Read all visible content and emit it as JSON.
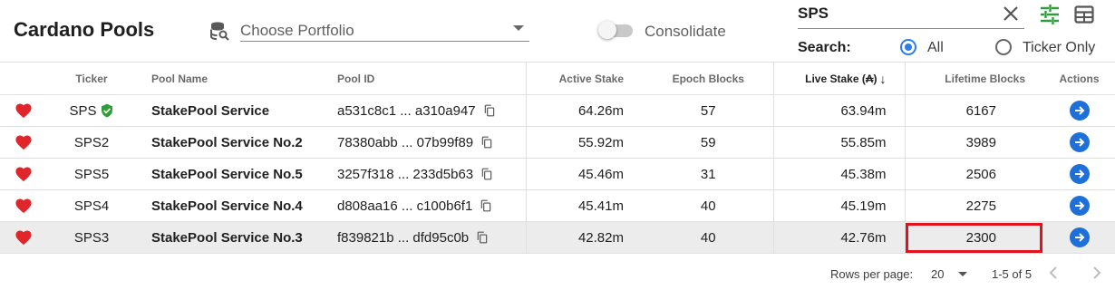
{
  "app": {
    "title": "Cardano Pools"
  },
  "portfolio": {
    "placeholder": "Choose Portfolio",
    "icon": "database-search-icon"
  },
  "consolidate": {
    "label": "Consolidate",
    "enabled": false
  },
  "search": {
    "value": "SPS",
    "mode_label": "Search:",
    "options": [
      {
        "label": "All",
        "checked": true
      },
      {
        "label": "Ticker Only",
        "checked": false
      }
    ]
  },
  "toolbar": {
    "filter_icon": "tune-icon",
    "layout_icon": "table-grid-icon",
    "accent": "#2e9d3a"
  },
  "table": {
    "columns": {
      "ticker": "Ticker",
      "pool_name": "Pool Name",
      "pool_id": "Pool ID",
      "active_stake": "Active Stake",
      "epoch_blocks": "Epoch Blocks",
      "live_stake": "Live Stake (₳)",
      "lifetime_blocks": "Lifetime Blocks",
      "actions": "Actions"
    },
    "sort": {
      "column": "live_stake",
      "direction": "desc"
    },
    "rows": [
      {
        "favorite": true,
        "ticker": "SPS",
        "verified": true,
        "pool_name": "StakePool Service",
        "pool_id": "a531c8c1 ... a310a947",
        "active_stake": "64.26m",
        "epoch_blocks": "57",
        "live_stake": "63.94m",
        "lifetime_blocks": "6167"
      },
      {
        "favorite": true,
        "ticker": "SPS2",
        "verified": false,
        "pool_name": "StakePool Service No.2",
        "pool_id": "78380abb ... 07b99f89",
        "active_stake": "55.92m",
        "epoch_blocks": "59",
        "live_stake": "55.85m",
        "lifetime_blocks": "3989"
      },
      {
        "favorite": true,
        "ticker": "SPS5",
        "verified": false,
        "pool_name": "StakePool Service No.5",
        "pool_id": "3257f318 ... 233d5b63",
        "active_stake": "45.46m",
        "epoch_blocks": "31",
        "live_stake": "45.38m",
        "lifetime_blocks": "2506"
      },
      {
        "favorite": true,
        "ticker": "SPS4",
        "verified": false,
        "pool_name": "StakePool Service No.4",
        "pool_id": "d808aa16 ... c100b6f1",
        "active_stake": "45.41m",
        "epoch_blocks": "40",
        "live_stake": "45.19m",
        "lifetime_blocks": "2275"
      },
      {
        "favorite": true,
        "ticker": "SPS3",
        "verified": false,
        "pool_name": "StakePool Service No.3",
        "pool_id": "f839821b ... dfd95c0b",
        "active_stake": "42.82m",
        "epoch_blocks": "40",
        "live_stake": "42.76m",
        "lifetime_blocks": "2300",
        "highlighted": true
      }
    ]
  },
  "pagination": {
    "rows_per_page_label": "Rows per page:",
    "rows_per_page": "20",
    "range": "1-5 of 5"
  },
  "colors": {
    "heart": "#e0252b",
    "verified": "#2e9d3a",
    "action": "#1f6fd8",
    "radio": "#2b7de9",
    "highlight_box": "#e3121a"
  }
}
